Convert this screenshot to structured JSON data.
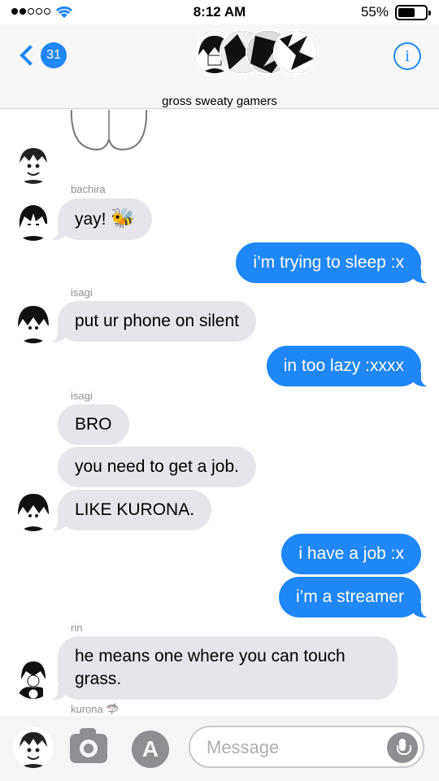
{
  "status_bar": {
    "time": "8:12 AM",
    "battery_percent": "55%",
    "battery_level": 0.55
  },
  "header": {
    "back_badge": "31",
    "group_name": "gross sweaty gamers",
    "info_icon": "info-icon"
  },
  "messages": [
    {
      "sender": "bachira",
      "text": "yay! ",
      "emoji": "🐝"
    },
    {
      "direction": "out",
      "text": "i’m trying to sleep :x"
    },
    {
      "sender": "isagi",
      "text": "put ur phone on silent"
    },
    {
      "direction": "out",
      "text": "in too lazy :xxxx"
    },
    {
      "sender": "isagi",
      "text": "BRO"
    },
    {
      "text": "you need to get a job."
    },
    {
      "text": "LIKE KURONA."
    },
    {
      "direction": "out",
      "text": "i have a job :x"
    },
    {
      "direction": "out",
      "text": "i’m a streamer"
    },
    {
      "sender": "rin",
      "text_line1": "he means one where you can touch",
      "text_line2": "grass."
    },
    {
      "sender": "kurona",
      "sender_emoji": "🦈"
    }
  ],
  "input": {
    "placeholder": "Message"
  },
  "colors": {
    "accent": "#1f87f7",
    "incoming_bubble": "#e6e5eb",
    "muted": "#8e8e93"
  }
}
